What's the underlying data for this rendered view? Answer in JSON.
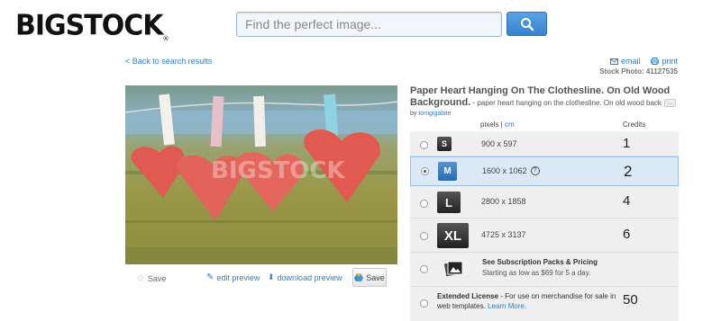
{
  "header": {
    "logo": "BIGSTOCK",
    "logo_mark": "®",
    "search_placeholder": "Find the perfect image...",
    "search_button_icon": "search-icon"
  },
  "nav": {
    "back": "< Back to search results",
    "email": "email",
    "print": "print",
    "stock_photo_label": "Stock Photo: 41127535"
  },
  "photo": {
    "watermark": "BIGSTOCK",
    "save": "Save",
    "edit_preview": "edit preview",
    "download_preview": "download preview",
    "drive_save": "Save"
  },
  "details": {
    "title": "Paper Heart Hanging On The Clothesline. On Old Wood Background.",
    "description": " - paper heart hanging on the clothesline. On old wood back",
    "more": "…",
    "by": "by",
    "author": "tomgigabite"
  },
  "pricing": {
    "col_pixels": "pixels",
    "col_sep": " | ",
    "col_cm": "cm",
    "col_credits": "Credits",
    "rows": [
      {
        "size": "S",
        "dims": "900 x 597",
        "credits": "1",
        "selected": false
      },
      {
        "size": "M",
        "dims": "1600 x 1062",
        "credits": "2",
        "selected": true,
        "help": "?"
      },
      {
        "size": "L",
        "dims": "2800 x 1858",
        "credits": "4",
        "selected": false
      },
      {
        "size": "XL",
        "dims": "4725 x 3137",
        "credits": "6",
        "selected": false
      }
    ],
    "subscription": {
      "title": "See Subscription Packs & Pricing",
      "text": "Starting as low as $69 for 5 a day."
    },
    "extended": {
      "label": "Extended License",
      "text": " - For use on merchandise for sale in web templates. ",
      "link": "Learn More.",
      "credits": "50"
    }
  },
  "colors": {
    "link": "#2f7dc5",
    "search_button": "#3583cf",
    "selected_row": "#dbe9f7",
    "table_bg": "#efefef"
  }
}
